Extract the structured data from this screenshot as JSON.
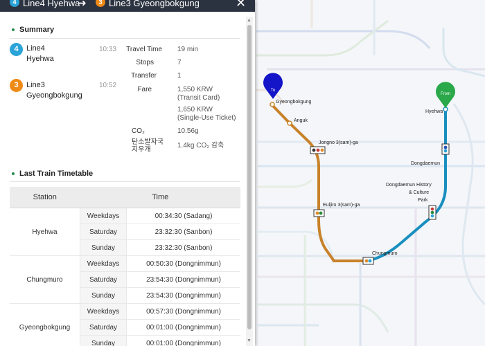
{
  "header": {
    "from_line_number": "4",
    "from_text": "Line4 Hyehwa",
    "to_line_number": "3",
    "to_text": "Line3 Gyeongbokgung",
    "arrow": "➜",
    "close": "✕"
  },
  "summary": {
    "title": "Summary",
    "legs": [
      {
        "number": "4",
        "line": "Line4",
        "station": "Hyehwa",
        "time": "10:33"
      },
      {
        "number": "3",
        "line": "Line3",
        "station": "Gyeongbokgung",
        "time": "10:52"
      }
    ],
    "stats": [
      {
        "label": "Travel Time",
        "value": "19 min"
      },
      {
        "label": "Stops",
        "value": "7"
      },
      {
        "label": "Transfer",
        "value": "1"
      },
      {
        "label": "Fare",
        "value": "1,550 KRW",
        "sub": "(Transit Card)"
      },
      {
        "label": "",
        "value": "1,650 KRW",
        "sub": "(Single-Use Ticket)"
      },
      {
        "label": "CO₂",
        "value": "10.56g"
      },
      {
        "label": "탄소발자국",
        "label2": "지우개",
        "value": "1.4kg CO₂ 감축"
      }
    ]
  },
  "timetable": {
    "title": "Last Train Timetable",
    "col_station": "Station",
    "col_time": "Time",
    "rows": [
      {
        "station": "Hyehwa",
        "entries": [
          {
            "day": "Weekdays",
            "time": "00:34:30 (Sadang)"
          },
          {
            "day": "Saturday",
            "time": "23:32:30 (Sanbon)"
          },
          {
            "day": "Sunday",
            "time": "23:32:30 (Sanbon)"
          }
        ]
      },
      {
        "station": "Chungmuro",
        "entries": [
          {
            "day": "Weekdays",
            "time": "00:50:30 (Dongnimmun)"
          },
          {
            "day": "Saturday",
            "time": "23:54:30 (Dongnimmun)"
          },
          {
            "day": "Sunday",
            "time": "23:54:30 (Dongnimmun)"
          }
        ]
      },
      {
        "station": "Gyeongbokgung",
        "entries": [
          {
            "day": "Weekdays",
            "time": "00:57:30 (Dongnimmun)"
          },
          {
            "day": "Saturday",
            "time": "00:01:00 (Dongnimmun)"
          },
          {
            "day": "Sunday",
            "time": "00:01:00 (Dongnimmun)"
          }
        ]
      }
    ]
  },
  "map": {
    "pin_to": "To",
    "pin_from": "From",
    "stations": {
      "gyeongbokgung": "Gyeongbokgung",
      "anguk": "Anguk",
      "jongno3": "Jongno 3(sam)-ga",
      "euljiro3": "Euljiro 3(sam)-ga",
      "chungmuro": "Chungmuro",
      "hyehwa": "Hyehwa",
      "dongdaemun": "Dongdaemun",
      "ddp1": "Dongdaemun History",
      "ddp2": "& Culture",
      "ddp3": "Park"
    }
  },
  "colors": {
    "line4": "#2aa3d8",
    "line3": "#ef8a17",
    "route_line4": "#1a8fbf",
    "route_line3": "#c8822a",
    "pin_to": "#1414c8",
    "pin_from": "#2aa84a",
    "header_bg": "#2c3340"
  }
}
